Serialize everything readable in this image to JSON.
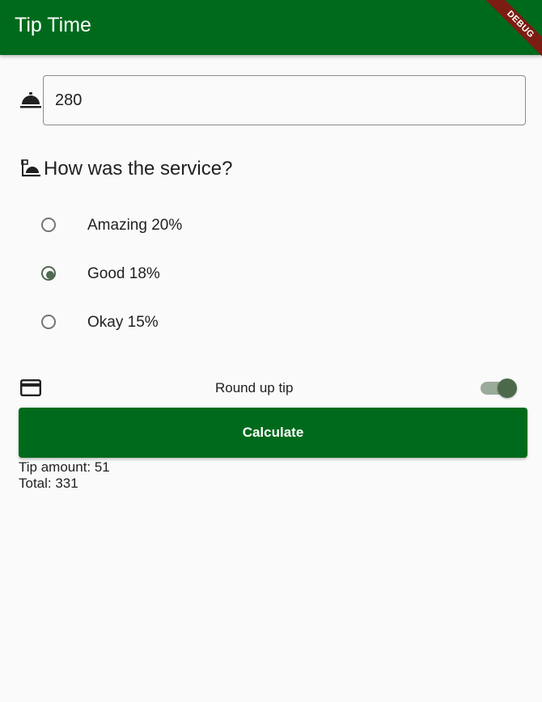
{
  "app_bar": {
    "title": "Tip Time",
    "debug_banner": "DEBUG",
    "color": "#006a1c"
  },
  "cost_input": {
    "value": "280",
    "icon": "room-service-icon"
  },
  "service": {
    "heading": "How was the service?",
    "icon": "room-service-outlined-icon",
    "options": [
      {
        "label": "Amazing 20%",
        "selected": false
      },
      {
        "label": "Good 18%",
        "selected": true
      },
      {
        "label": "Okay 15%",
        "selected": false
      }
    ]
  },
  "round_up": {
    "label": "Round up tip",
    "icon": "credit-card-icon",
    "enabled": true
  },
  "calculate_button": {
    "label": "Calculate"
  },
  "results": {
    "tip": "Tip amount: 51",
    "total": "Total: 331"
  }
}
